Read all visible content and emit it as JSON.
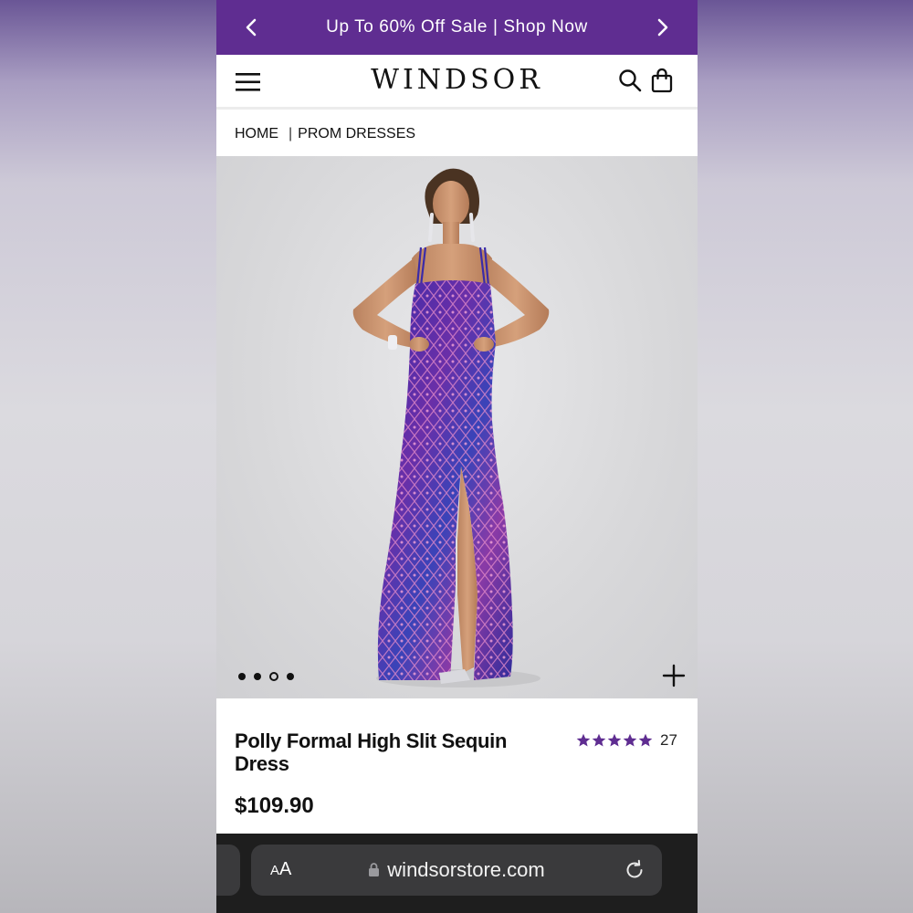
{
  "promo": {
    "text": "Up To 60% Off Sale | Shop Now",
    "prev_icon": "chevron-left-icon",
    "next_icon": "chevron-right-icon",
    "background": "#5f2d91"
  },
  "header": {
    "logo": "WINDSOR",
    "menu_icon": "hamburger-menu-icon",
    "search_icon": "search-icon",
    "bag_icon": "shopping-bag-icon"
  },
  "breadcrumb": {
    "items": [
      "HOME",
      "PROM DRESSES"
    ],
    "separator": "|"
  },
  "gallery": {
    "image_count": 4,
    "active_index": 2,
    "zoom_icon": "plus-icon"
  },
  "product": {
    "title": "Polly Formal High Slit Sequin Dress",
    "price": "$109.90",
    "rating": 5,
    "rating_max": 5,
    "review_count": "27",
    "star_color": "#5f2d91"
  },
  "browser": {
    "text_size_label": "AA",
    "url": "windsorstore.com",
    "lock_icon": "lock-icon",
    "reload_icon": "reload-icon"
  }
}
